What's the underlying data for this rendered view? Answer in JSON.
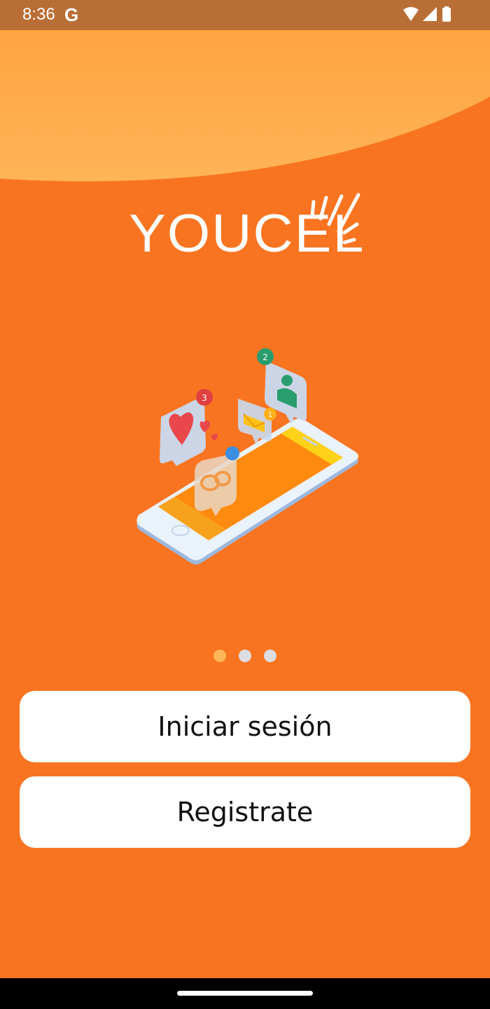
{
  "status_bar": {
    "time": "8:36",
    "google_icon_letter": "G",
    "icons": [
      "wifi-icon",
      "signal-icon",
      "battery-icon"
    ]
  },
  "logo": {
    "text": "YOUCEL"
  },
  "illustration": {
    "badges": [
      "3",
      "2",
      "1"
    ]
  },
  "pager": {
    "pages": 3,
    "active_index": 0
  },
  "buttons": {
    "login": "Iniciar sesión",
    "register": "Registrate"
  },
  "colors": {
    "background": "#F97420",
    "header_wave": "#FFA94A",
    "status_bar": "#B96E35",
    "dot_active": "#FDB65A",
    "dot_inactive": "#DDDDE2",
    "button_bg": "#FFFFFF"
  }
}
